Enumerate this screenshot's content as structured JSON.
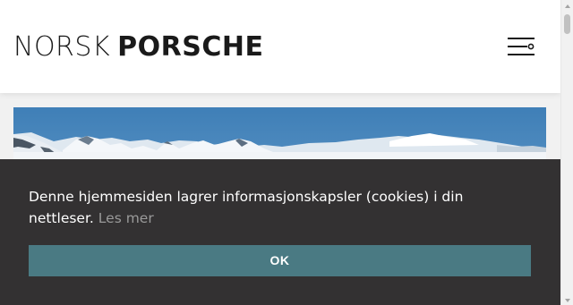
{
  "header": {
    "logo_light": "NORSK",
    "logo_bold": "PORSCHE",
    "menu_icon": "hamburger-menu-icon"
  },
  "hero": {
    "image": "snowy-mountains-image"
  },
  "cookie_banner": {
    "message": "Denne hjemmesiden lagrer informasjonskapsler (cookies) i din nettleser.",
    "more_link": "Les mer",
    "ok_label": "OK"
  },
  "colors": {
    "banner_background": "#333132",
    "ok_button": "#4a7a83",
    "link_text": "#9a9a9a",
    "logo_text": "#1a1a1a"
  }
}
